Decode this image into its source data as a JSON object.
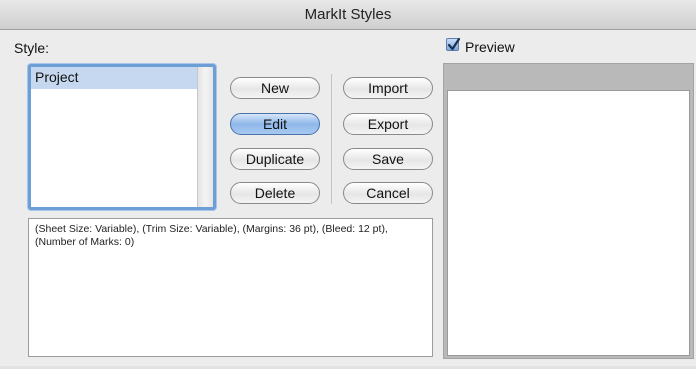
{
  "window": {
    "title": "MarkIt Styles"
  },
  "style_section": {
    "label": "Style:",
    "items": [
      {
        "label": "Project",
        "selected": true
      }
    ]
  },
  "buttons": {
    "new": "New",
    "edit": "Edit",
    "duplicate": "Duplicate",
    "delete": "Delete",
    "import": "Import",
    "export": "Export",
    "save": "Save",
    "cancel": "Cancel"
  },
  "description": "(Sheet Size: Variable), (Trim Size: Variable), (Margins: 36 pt), (Bleed: 12 pt), (Number of Marks: 0)",
  "preview": {
    "label": "Preview",
    "checked": true
  },
  "colors": {
    "default_button": "#8fb8ea",
    "selection": "#c6d8f0",
    "focus_ring": "#6d9ed6"
  }
}
